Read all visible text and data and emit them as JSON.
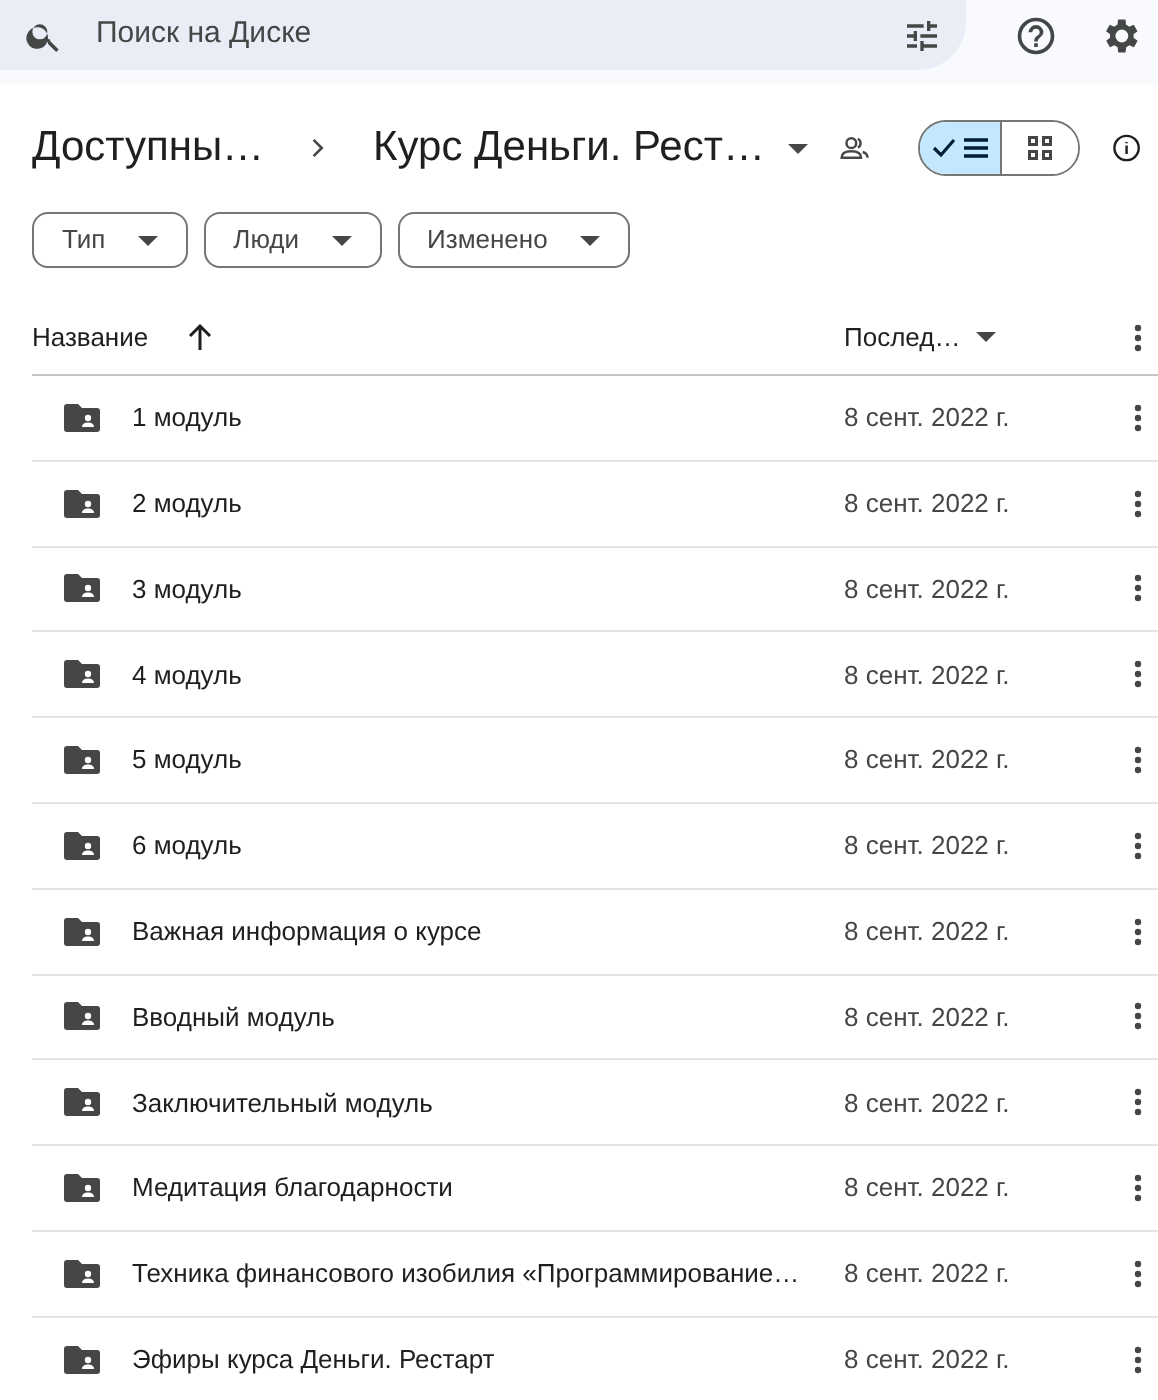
{
  "search": {
    "placeholder": "Поиск на Диске"
  },
  "breadcrumb": [
    {
      "label": "Доступны…"
    },
    {
      "label": "Курс Деньги. Рест…"
    }
  ],
  "view_toggle": [
    {
      "kind": "list",
      "selected": true
    },
    {
      "kind": "grid",
      "selected": false
    }
  ],
  "filters": [
    {
      "label": "Тип"
    },
    {
      "label": "Люди"
    },
    {
      "label": "Изменено"
    }
  ],
  "table": {
    "columns": [
      {
        "label": "Название",
        "sort_ascending": true
      },
      {
        "label": "Послед…"
      }
    ],
    "rows": [
      {
        "name": "1 модуль",
        "date": "8 сент. 2022 г."
      },
      {
        "name": "2 модуль",
        "date": "8 сент. 2022 г."
      },
      {
        "name": "3 модуль",
        "date": "8 сент. 2022 г."
      },
      {
        "name": "4 модуль",
        "date": "8 сент. 2022 г."
      },
      {
        "name": "5 модуль",
        "date": "8 сент. 2022 г."
      },
      {
        "name": "6 модуль",
        "date": "8 сент. 2022 г."
      },
      {
        "name": "Важная информация о курсе",
        "date": "8 сент. 2022 г."
      },
      {
        "name": "Вводный модуль",
        "date": "8 сент. 2022 г."
      },
      {
        "name": "Заключительный модуль",
        "date": "8 сент. 2022 г."
      },
      {
        "name": "Медитация благодарности",
        "date": "8 сент. 2022 г."
      },
      {
        "name": "Техника финансового изобилия «Программирование…",
        "date": "8 сент. 2022 г."
      },
      {
        "name": "Эфиры курса Деньги. Рестарт",
        "date": "8 сент. 2022 г."
      }
    ]
  }
}
